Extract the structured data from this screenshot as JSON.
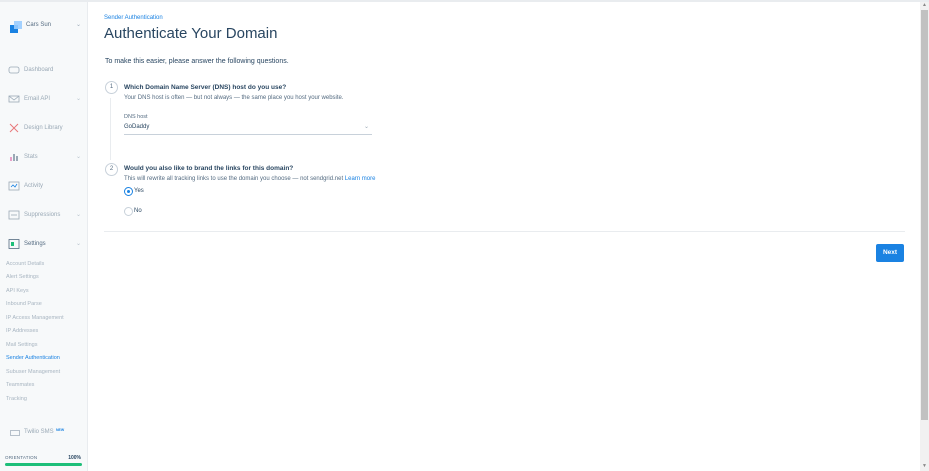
{
  "sidebar": {
    "account_name": "Cars Sun",
    "nav_items": [
      {
        "label": "Dashboard",
        "icon": "dashboard-icon",
        "has_chevron": false
      },
      {
        "label": "Email API",
        "icon": "email-api-icon",
        "has_chevron": true
      },
      {
        "label": "Design Library",
        "icon": "design-library-icon",
        "has_chevron": false
      },
      {
        "label": "Stats",
        "icon": "stats-icon",
        "has_chevron": true
      },
      {
        "label": "Activity",
        "icon": "activity-icon",
        "has_chevron": false
      },
      {
        "label": "Suppressions",
        "icon": "suppressions-icon",
        "has_chevron": true
      },
      {
        "label": "Settings",
        "icon": "settings-icon",
        "has_chevron": true
      }
    ],
    "settings_items": [
      "Account Details",
      "Alert Settings",
      "API Keys",
      "Inbound Parse",
      "IP Access Management",
      "IP Addresses",
      "Mail Settings",
      "Sender Authentication",
      "Subuser Management",
      "Teammates",
      "Tracking"
    ],
    "active_settings_item": "Sender Authentication",
    "twilio_sms_label": "Twilio SMS",
    "twilio_sms_badge": "NEW",
    "orientation_label": "ORIENTATION",
    "orientation_percent": "100%",
    "orientation_progress": 1.0
  },
  "main": {
    "breadcrumb": "Sender Authentication",
    "title": "Authenticate Your Domain",
    "intro": "To make this easier, please answer the following questions.",
    "q1": {
      "number": "1",
      "title": "Which Domain Name Server (DNS) host do you use?",
      "description": "Your DNS host is often — but not always — the same place you host your website.",
      "field_label": "DNS host",
      "field_value": "GoDaddy"
    },
    "q2": {
      "number": "2",
      "title": "Would you also like to brand the links for this domain?",
      "description": "This will rewrite all tracking links to use the domain you choose — not sendgrid.net",
      "learn_more": "Learn more",
      "options": [
        {
          "label": "Yes",
          "selected": true
        },
        {
          "label": "No",
          "selected": false
        }
      ]
    },
    "next_label": "Next"
  },
  "colors": {
    "accent": "#1a82e2",
    "text": "#294661",
    "progress": "#1ebf79"
  }
}
